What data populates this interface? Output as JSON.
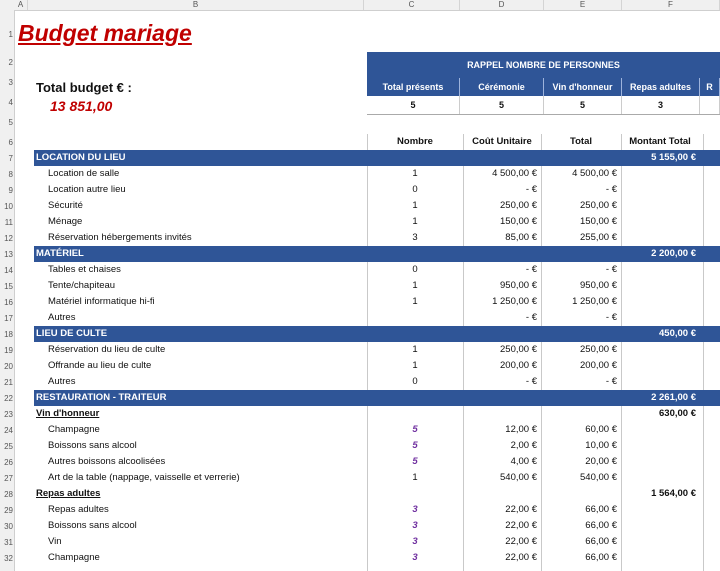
{
  "columns": [
    "A",
    "B",
    "C",
    "D",
    "E",
    "F"
  ],
  "rows": [
    "1",
    "2",
    "3",
    "4",
    "5",
    "6",
    "7",
    "8",
    "9",
    "10",
    "11",
    "12",
    "13",
    "14",
    "15",
    "16",
    "17",
    "18",
    "19",
    "20",
    "21",
    "22",
    "23",
    "24",
    "25",
    "26",
    "27",
    "28",
    "29",
    "30",
    "31",
    "32"
  ],
  "title": "Budget mariage",
  "total_label": "Total budget € :",
  "total_value": "13 851,00",
  "rappel": {
    "header": "RAPPEL NOMBRE DE PERSONNES",
    "cols": [
      "Total présents",
      "Cérémonie",
      "Vin d'honneur",
      "Repas adultes",
      "R"
    ],
    "values": [
      "5",
      "5",
      "5",
      "3",
      ""
    ]
  },
  "table_headers": {
    "nombre": "Nombre",
    "cout": "Coût Unitaire",
    "total": "Total",
    "montant": "Montant Total"
  },
  "lines": [
    {
      "type": "section",
      "label": "LOCATION DU LIEU",
      "montant": "5 155,00 €"
    },
    {
      "type": "item",
      "label": "Location de salle",
      "nombre": "1",
      "cout": "4 500,00 €",
      "total": "4 500,00 €"
    },
    {
      "type": "item",
      "label": "Location autre lieu",
      "nombre": "0",
      "cout": "-    €",
      "total": "-    €"
    },
    {
      "type": "item",
      "label": "Sécurité",
      "nombre": "1",
      "cout": "250,00 €",
      "total": "250,00 €"
    },
    {
      "type": "item",
      "label": "Ménage",
      "nombre": "1",
      "cout": "150,00 €",
      "total": "150,00 €"
    },
    {
      "type": "item",
      "label": "Réservation hébergements invités",
      "nombre": "3",
      "cout": "85,00 €",
      "total": "255,00 €"
    },
    {
      "type": "section",
      "label": "MATÉRIEL",
      "montant": "2 200,00 €"
    },
    {
      "type": "item",
      "label": "Tables et chaises",
      "nombre": "0",
      "cout": "-    €",
      "total": "-    €"
    },
    {
      "type": "item",
      "label": "Tente/chapiteau",
      "nombre": "1",
      "cout": "950,00 €",
      "total": "950,00 €"
    },
    {
      "type": "item",
      "label": "Matériel informatique hi-fi",
      "nombre": "1",
      "cout": "1 250,00 €",
      "total": "1 250,00 €"
    },
    {
      "type": "item",
      "label": "Autres",
      "nombre": "",
      "cout": "-    €",
      "total": "-    €"
    },
    {
      "type": "section",
      "label": "LIEU DE CULTE",
      "montant": "450,00 €"
    },
    {
      "type": "item",
      "label": "Réservation du lieu de culte",
      "nombre": "1",
      "cout": "250,00 €",
      "total": "250,00 €"
    },
    {
      "type": "item",
      "label": "Offrande au lieu de culte",
      "nombre": "1",
      "cout": "200,00 €",
      "total": "200,00 €"
    },
    {
      "type": "item",
      "label": "Autres",
      "nombre": "0",
      "cout": "-    €",
      "total": "-    €"
    },
    {
      "type": "section",
      "label": "RESTAURATION - TRAITEUR",
      "montant": "2 261,00 €"
    },
    {
      "type": "sub",
      "label": "Vin d'honneur",
      "montant": "630,00 €"
    },
    {
      "type": "item",
      "label": "Champagne",
      "nombre": "5",
      "purple": true,
      "cout": "12,00 €",
      "total": "60,00 €"
    },
    {
      "type": "item",
      "label": "Boissons sans alcool",
      "nombre": "5",
      "purple": true,
      "cout": "2,00 €",
      "total": "10,00 €"
    },
    {
      "type": "item",
      "label": "Autres boissons alcoolisées",
      "nombre": "5",
      "purple": true,
      "cout": "4,00 €",
      "total": "20,00 €"
    },
    {
      "type": "item",
      "label": "Art de la table (nappage, vaisselle et verrerie)",
      "nombre": "1",
      "cout": "540,00 €",
      "total": "540,00 €"
    },
    {
      "type": "sub",
      "label": "Repas adultes",
      "montant": "1 564,00 €"
    },
    {
      "type": "item",
      "label": "Repas adultes",
      "nombre": "3",
      "purple": true,
      "cout": "22,00 €",
      "total": "66,00 €"
    },
    {
      "type": "item",
      "label": "Boissons sans alcool",
      "nombre": "3",
      "purple": true,
      "cout": "22,00 €",
      "total": "66,00 €"
    },
    {
      "type": "item",
      "label": "Vin",
      "nombre": "3",
      "purple": true,
      "cout": "22,00 €",
      "total": "66,00 €"
    },
    {
      "type": "item",
      "label": "Champagne",
      "nombre": "3",
      "purple": true,
      "cout": "22,00 €",
      "total": "66,00 €"
    }
  ],
  "colors": {
    "header_blue": "#2f5597",
    "title_red": "#c00000",
    "qty_purple": "#7030a0"
  }
}
